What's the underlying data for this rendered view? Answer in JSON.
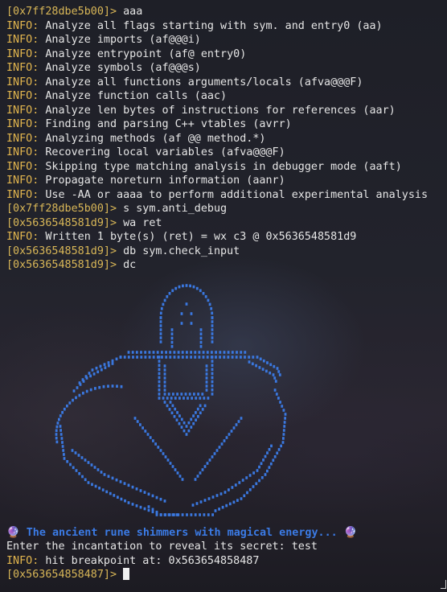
{
  "terminal": {
    "lines": [
      {
        "kind": "cmd",
        "prompt": "[0x7ff28dbe5b00]>",
        "text": " aaa"
      },
      {
        "kind": "info",
        "tag": "INFO:",
        "text": " Analyze all flags starting with sym. and entry0 (aa)"
      },
      {
        "kind": "info",
        "tag": "INFO:",
        "text": " Analyze imports (af@@@i)"
      },
      {
        "kind": "info",
        "tag": "INFO:",
        "text": " Analyze entrypoint (af@ entry0)"
      },
      {
        "kind": "info",
        "tag": "INFO:",
        "text": " Analyze symbols (af@@@s)"
      },
      {
        "kind": "info",
        "tag": "INFO:",
        "text": " Analyze all functions arguments/locals (afva@@@F)"
      },
      {
        "kind": "info",
        "tag": "INFO:",
        "text": " Analyze function calls (aac)"
      },
      {
        "kind": "info",
        "tag": "INFO:",
        "text": " Analyze len bytes of instructions for references (aar)"
      },
      {
        "kind": "info",
        "tag": "INFO:",
        "text": " Finding and parsing C++ vtables (avrr)"
      },
      {
        "kind": "info",
        "tag": "INFO:",
        "text": " Analyzing methods (af @@ method.*)"
      },
      {
        "kind": "info",
        "tag": "INFO:",
        "text": " Recovering local variables (afva@@@F)"
      },
      {
        "kind": "info",
        "tag": "INFO:",
        "text": " Skipping type matching analysis in debugger mode (aaft)"
      },
      {
        "kind": "info",
        "tag": "INFO:",
        "text": " Propagate noreturn information (aanr)"
      },
      {
        "kind": "info",
        "tag": "INFO:",
        "text": " Use -AA or aaaa to perform additional experimental analysis"
      },
      {
        "kind": "cmd",
        "prompt": "[0x7ff28dbe5b00]>",
        "text": " s sym.anti_debug"
      },
      {
        "kind": "cmd",
        "prompt": "[0x5636548581d9]>",
        "text": " wa ret"
      },
      {
        "kind": "info",
        "tag": "INFO:",
        "text": " Written 1 byte(s) (ret) = wx c3 @ 0x5636548581d9"
      },
      {
        "kind": "cmd",
        "prompt": "[0x5636548581d9]>",
        "text": " db sym.check_input"
      },
      {
        "kind": "cmd",
        "prompt": "[0x5636548581d9]>",
        "text": " dc"
      },
      {
        "kind": "blank"
      },
      {
        "kind": "blank"
      },
      {
        "kind": "blank"
      },
      {
        "kind": "blank"
      },
      {
        "kind": "blank"
      },
      {
        "kind": "blank"
      },
      {
        "kind": "blank"
      },
      {
        "kind": "blank"
      },
      {
        "kind": "blank"
      },
      {
        "kind": "blank"
      },
      {
        "kind": "blank"
      },
      {
        "kind": "blank"
      },
      {
        "kind": "blank"
      },
      {
        "kind": "blank"
      },
      {
        "kind": "blank"
      },
      {
        "kind": "blank"
      },
      {
        "kind": "blank"
      },
      {
        "kind": "blank"
      },
      {
        "kind": "rune",
        "orb_left": "🔮",
        "text": " The ancient rune shimmers with magical energy... ",
        "orb_right": "🔮"
      },
      {
        "kind": "plain",
        "text": "Enter the incantation to reveal its secret: test"
      },
      {
        "kind": "info",
        "tag": "INFO:",
        "text": " hit breakpoint at: 0x563654858487"
      },
      {
        "kind": "cmd",
        "prompt": "[0x563654858487]>",
        "text": " ",
        "cursor": true
      }
    ]
  },
  "ascii_art": {
    "description_icon": "rune-figure-icon",
    "color": "#3a78e0"
  },
  "colors": {
    "prompt": "#d8b657",
    "info_tag": "#e0b44e",
    "text": "#e6e6e6",
    "rune_text": "#3b7be6"
  }
}
